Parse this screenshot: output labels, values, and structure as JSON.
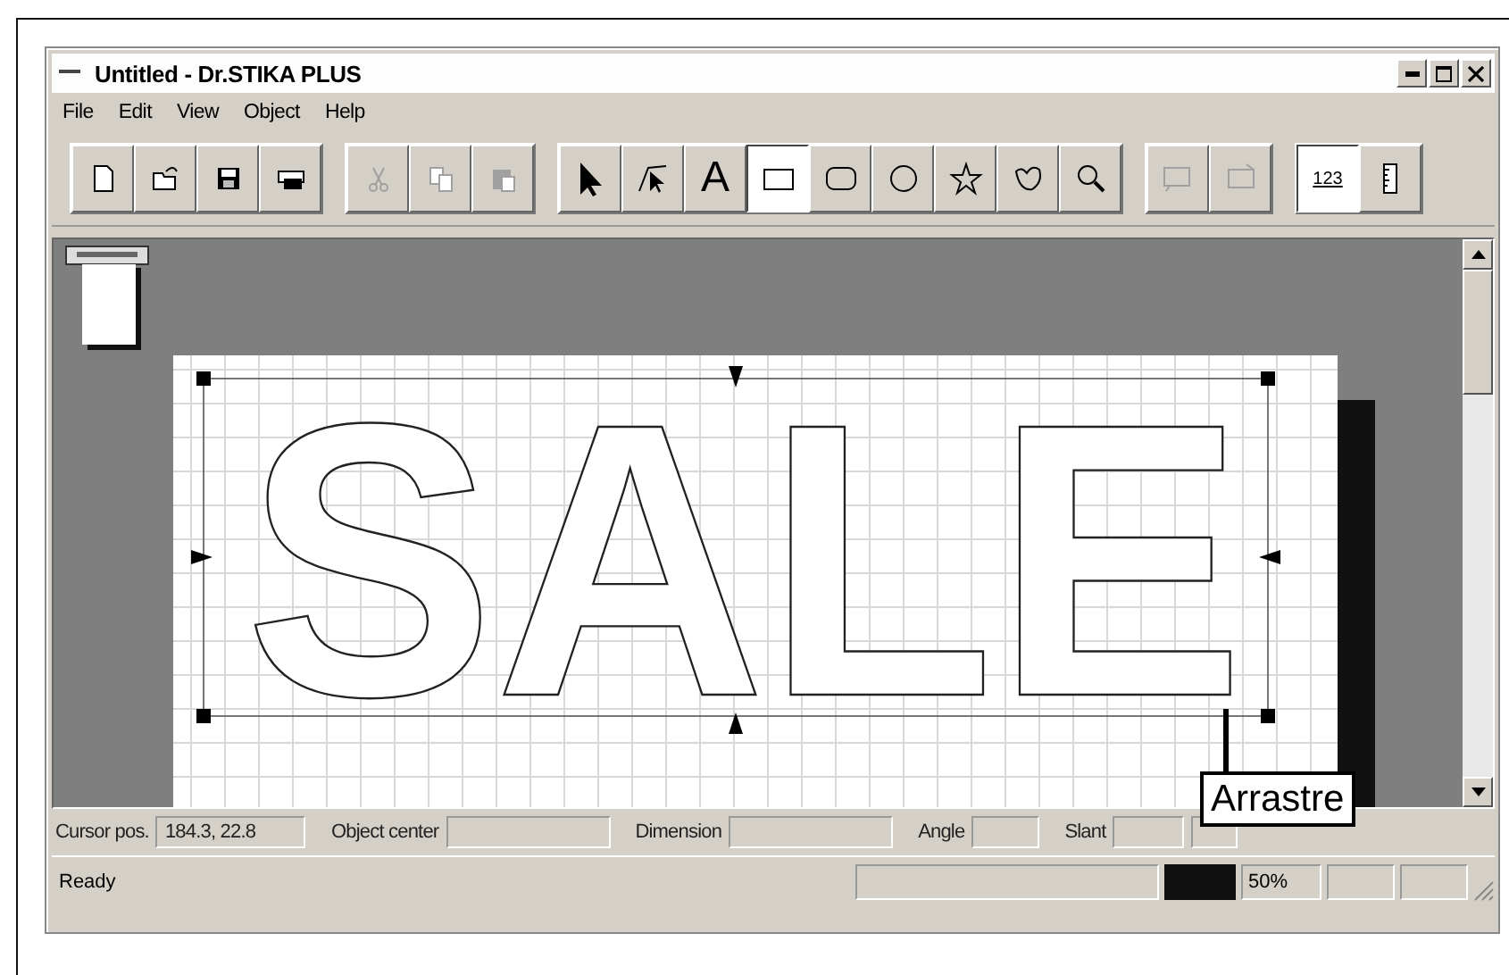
{
  "window": {
    "title": "Untitled - Dr.STIKA PLUS"
  },
  "menu": [
    {
      "label": "File"
    },
    {
      "label": "Edit"
    },
    {
      "label": "View"
    },
    {
      "label": "Object"
    },
    {
      "label": "Help"
    }
  ],
  "toolbar": [
    [
      {
        "kind": "new",
        "disabled": false,
        "selected": false
      },
      {
        "kind": "open",
        "disabled": false,
        "selected": false
      },
      {
        "kind": "save",
        "disabled": false,
        "selected": false
      },
      {
        "kind": "print",
        "disabled": false,
        "selected": false
      }
    ],
    [
      {
        "kind": "cut",
        "disabled": true,
        "selected": false
      },
      {
        "kind": "copy",
        "disabled": true,
        "selected": false
      },
      {
        "kind": "paste",
        "disabled": true,
        "selected": false
      }
    ],
    [
      {
        "kind": "pointer",
        "disabled": false,
        "selected": false
      },
      {
        "kind": "node",
        "disabled": false,
        "selected": false
      },
      {
        "kind": "text",
        "label": "A",
        "disabled": false,
        "selected": false
      },
      {
        "kind": "rectangle",
        "disabled": false,
        "selected": true
      },
      {
        "kind": "rounded",
        "disabled": false,
        "selected": false
      },
      {
        "kind": "ellipse",
        "disabled": false,
        "selected": false
      },
      {
        "kind": "star",
        "disabled": false,
        "selected": false
      },
      {
        "kind": "freehand",
        "disabled": false,
        "selected": false
      },
      {
        "kind": "zoom",
        "disabled": false,
        "selected": false
      }
    ],
    [
      {
        "kind": "send",
        "disabled": true,
        "selected": false
      },
      {
        "kind": "receive",
        "disabled": true,
        "selected": false
      }
    ],
    [
      {
        "kind": "numbers",
        "label": "123",
        "disabled": false,
        "selected": true
      },
      {
        "kind": "ruler",
        "disabled": false,
        "selected": false
      }
    ]
  ],
  "canvas": {
    "artwork_text": "SALE"
  },
  "callout": {
    "label": "Arrastre"
  },
  "status_bar": {
    "fields": [
      {
        "label": "Cursor pos.",
        "value": "184.3, 22.8"
      },
      {
        "label": "Object center"
      },
      {
        "label": "Dimension"
      },
      {
        "label": "Angle"
      },
      {
        "label": "Slant"
      }
    ],
    "message": "Ready",
    "zoom": "50%"
  }
}
